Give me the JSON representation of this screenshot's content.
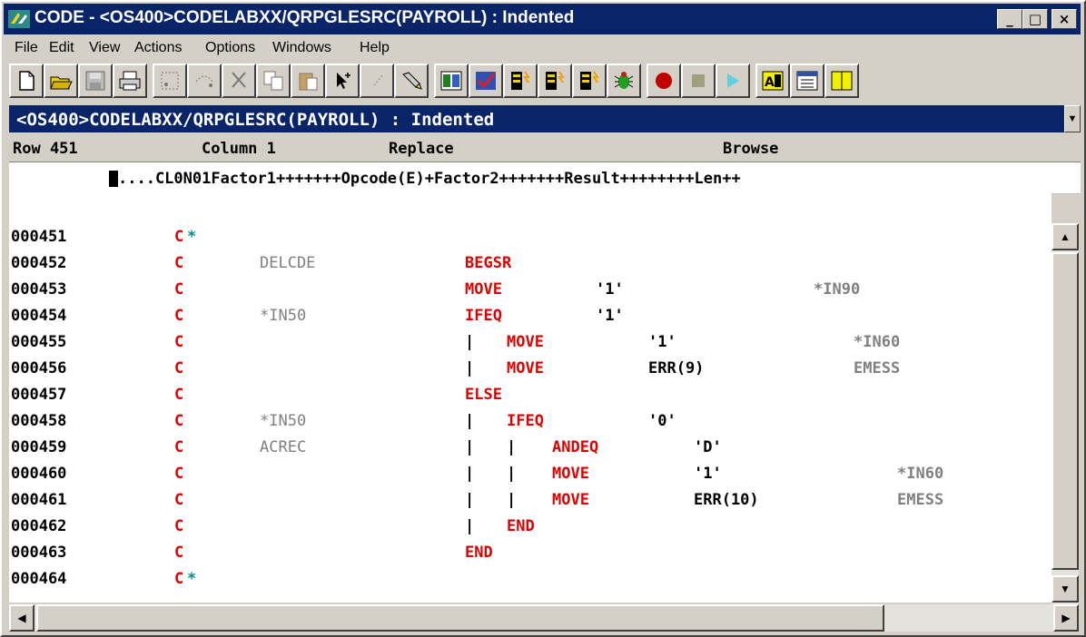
{
  "window": {
    "title": "CODE - <OS400>CODELABXX/QRPGLESRC(PAYROLL) : Indented",
    "controls": {
      "minimize": "_",
      "maximize": "□",
      "close": "×"
    }
  },
  "menu": [
    {
      "label": "File"
    },
    {
      "label": "Edit"
    },
    {
      "label": "View"
    },
    {
      "label": "Actions"
    },
    {
      "label": "Options"
    },
    {
      "label": "Windows"
    },
    {
      "label": "Help"
    }
  ],
  "toolbar_icons": [
    "new-file-icon",
    "open-folder-icon",
    "save-icon",
    "print-icon",
    "cut-dotted-icon",
    "lasso-icon",
    "scissors-icon",
    "copy-icon",
    "paste-icon",
    "pointer-plus-icon",
    "select-icon",
    "flashlight-icon",
    "window-tile-icon",
    "checkmark-icon",
    "build-icon",
    "run-icon",
    "debug-icon",
    "bug-icon",
    "record-icon",
    "stop-icon",
    "play-icon",
    "format-icon",
    "calendar-icon",
    "split-icon"
  ],
  "document_header": "<OS400>CODELABXX/QRPGLESRC(PAYROLL) : Indented",
  "status": {
    "row": "Row 451",
    "column": "Column 1",
    "mode": "Replace",
    "access": "Browse"
  },
  "ruler": "....CL0N01Factor1+++++++Opcode(E)+Factor2+++++++Result++++++++Len++",
  "colors": {
    "title_bar": "#0a246a",
    "opcode": "#e00000",
    "comment_marker": "#009090",
    "field": "#808080"
  },
  "lines": [
    {
      "seq": "000451",
      "spec": "C",
      "ast": "*",
      "f1": "",
      "indent": "",
      "op": "",
      "f2": "",
      "res": ""
    },
    {
      "seq": "000452",
      "spec": "C",
      "ast": "",
      "f1": "DELCDE",
      "indent": "",
      "op": "BEGSR",
      "f2": "",
      "res": ""
    },
    {
      "seq": "000453",
      "spec": "C",
      "ast": "",
      "f1": "",
      "indent": "",
      "op": "MOVE",
      "f2": "'1'",
      "res": "*IN90"
    },
    {
      "seq": "000454",
      "spec": "C",
      "ast": "",
      "f1": "*IN50",
      "indent": "",
      "op": "IFEQ",
      "f2": "'1'",
      "res": ""
    },
    {
      "seq": "000455",
      "spec": "C",
      "ast": "",
      "f1": "",
      "indent": "|",
      "op": "MOVE",
      "f2": "'1'",
      "res": "*IN60"
    },
    {
      "seq": "000456",
      "spec": "C",
      "ast": "",
      "f1": "",
      "indent": "|",
      "op": "MOVE",
      "f2": "ERR(9)",
      "res": "EMESS"
    },
    {
      "seq": "000457",
      "spec": "C",
      "ast": "",
      "f1": "",
      "indent": "",
      "op": "ELSE",
      "f2": "",
      "res": ""
    },
    {
      "seq": "000458",
      "spec": "C",
      "ast": "",
      "f1": "*IN50",
      "indent": "|",
      "op": "IFEQ",
      "f2": "'0'",
      "res": ""
    },
    {
      "seq": "000459",
      "spec": "C",
      "ast": "",
      "f1": "ACREC",
      "indent": "| |",
      "op": "ANDEQ",
      "f2": "'D'",
      "res": ""
    },
    {
      "seq": "000460",
      "spec": "C",
      "ast": "",
      "f1": "",
      "indent": "| |",
      "op": "MOVE",
      "f2": "'1'",
      "res": "*IN60"
    },
    {
      "seq": "000461",
      "spec": "C",
      "ast": "",
      "f1": "",
      "indent": "| |",
      "op": "MOVE",
      "f2": "ERR(10)",
      "res": "EMESS"
    },
    {
      "seq": "000462",
      "spec": "C",
      "ast": "",
      "f1": "",
      "indent": "|",
      "op": "END",
      "f2": "",
      "res": ""
    },
    {
      "seq": "000463",
      "spec": "C",
      "ast": "",
      "f1": "",
      "indent": "",
      "op": "END",
      "f2": "",
      "res": ""
    },
    {
      "seq": "000464",
      "spec": "C",
      "ast": "*",
      "f1": "",
      "indent": "",
      "op": "",
      "f2": "",
      "res": ""
    }
  ]
}
